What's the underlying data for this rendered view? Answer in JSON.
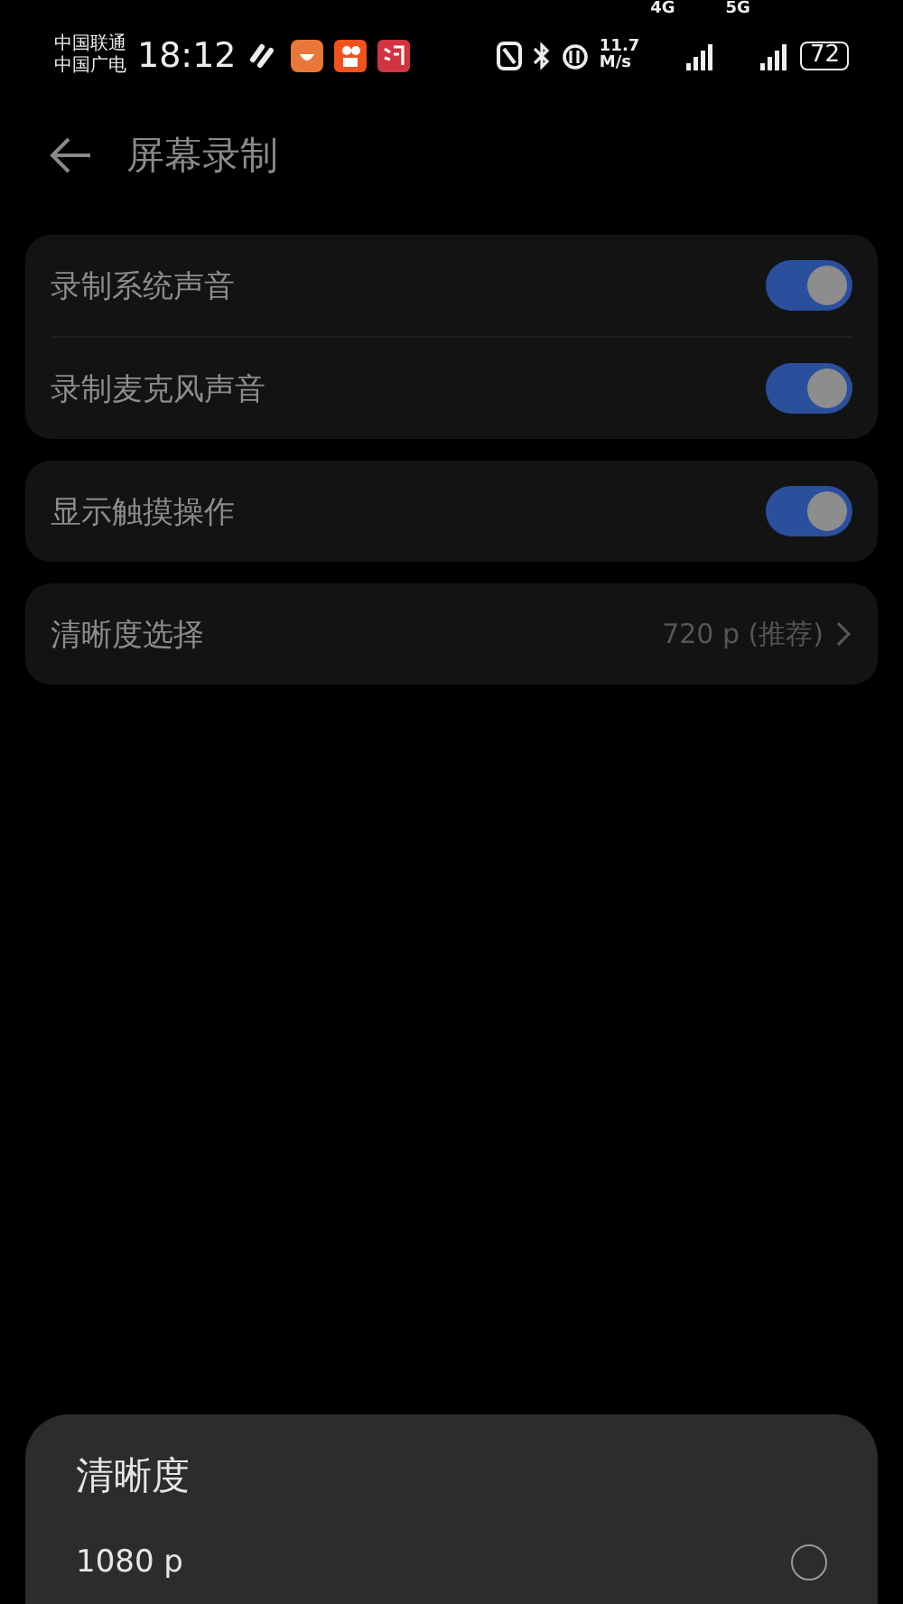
{
  "status_bar": {
    "carriers": [
      "中国联通",
      "中国广电"
    ],
    "time": "18:12",
    "speed": [
      "11.7",
      "M/s"
    ],
    "networks": [
      "4G",
      "5G"
    ],
    "battery": "72"
  },
  "header": {
    "title": "屏幕录制"
  },
  "groups": [
    {
      "items": [
        {
          "kind": "toggle",
          "label": "录制系统声音",
          "on": true
        },
        {
          "kind": "toggle",
          "label": "录制麦克风声音",
          "on": true
        }
      ]
    },
    {
      "items": [
        {
          "kind": "toggle",
          "label": "显示触摸操作",
          "on": true
        }
      ]
    },
    {
      "items": [
        {
          "kind": "link",
          "label": "清晰度选择",
          "value": "720 p (推荐)"
        }
      ]
    }
  ],
  "sheet": {
    "title": "清晰度",
    "options": [
      {
        "label": "1080 p",
        "selected": false
      }
    ]
  }
}
